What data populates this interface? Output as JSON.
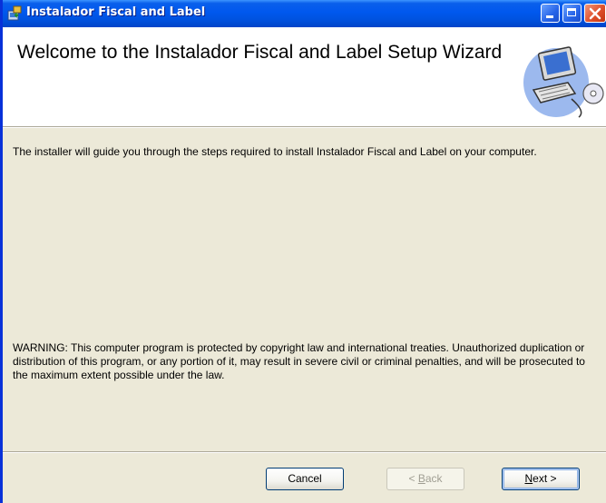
{
  "window": {
    "title": "Instalador Fiscal and Label"
  },
  "header": {
    "title": "Welcome to the Instalador Fiscal and Label Setup Wizard"
  },
  "body": {
    "intro": "The installer will guide you through the steps required to install Instalador Fiscal and Label on your computer.",
    "warning": "WARNING: This computer program is protected by copyright law and international treaties. Unauthorized duplication or distribution of this program, or any portion of it, may result in severe civil or criminal penalties, and will be prosecuted to the maximum extent possible under the law."
  },
  "buttons": {
    "cancel": "Cancel",
    "back_mnemonic": "B",
    "back_rest": "ack",
    "next_mnemonic": "N",
    "next_rest": "ext >"
  },
  "icons": {
    "window": "installer-icon",
    "header": "computer-setup-icon"
  },
  "colors": {
    "titlebar": "#0058EE",
    "dialog_bg": "#ECE9D8",
    "header_bg": "#FFFFFF"
  }
}
